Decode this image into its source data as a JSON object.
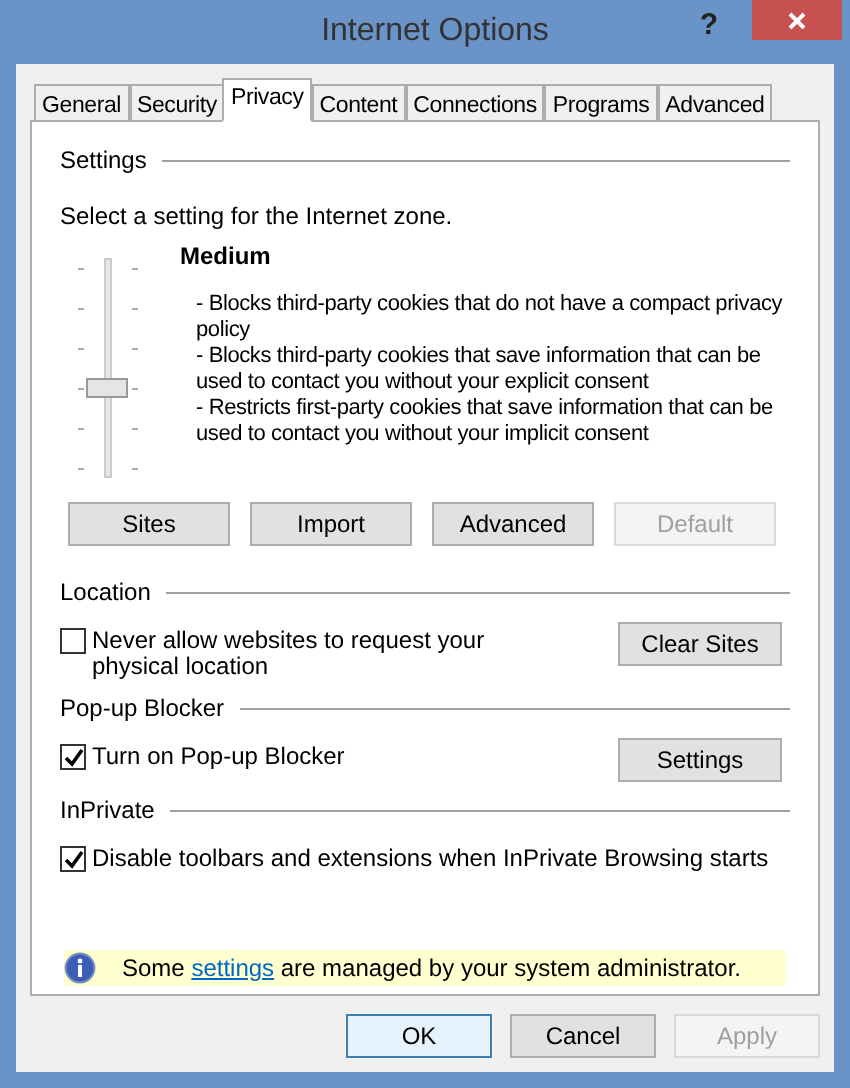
{
  "window": {
    "title": "Internet Options",
    "help": "?"
  },
  "tabs": [
    {
      "label": "General",
      "selected": false
    },
    {
      "label": "Security",
      "selected": false
    },
    {
      "label": "Privacy",
      "selected": true
    },
    {
      "label": "Content",
      "selected": false
    },
    {
      "label": "Connections",
      "selected": false
    },
    {
      "label": "Programs",
      "selected": false
    },
    {
      "label": "Advanced",
      "selected": false
    }
  ],
  "settings": {
    "heading": "Settings",
    "prompt": "Select a setting for the Internet zone.",
    "slider": {
      "level": 0.4
    },
    "level_name": "Medium",
    "description": [
      "- Blocks third-party cookies that do not have a compact privacy policy",
      "- Blocks third-party cookies that save information that can be used to contact you without your explicit consent",
      "- Restricts first-party cookies that save information that can be used to contact you without your implicit consent"
    ],
    "buttons": [
      {
        "label": "Sites",
        "disabled": false
      },
      {
        "label": "Import",
        "disabled": false
      },
      {
        "label": "Advanced",
        "disabled": false
      },
      {
        "label": "Default",
        "disabled": true
      }
    ]
  },
  "sections": [
    {
      "heading": "Location",
      "checkbox": {
        "label": "Never allow websites to request your physical location",
        "checked": false
      },
      "button": "Clear Sites"
    },
    {
      "heading": "Pop-up Blocker",
      "checkbox": {
        "label": "Turn on Pop-up Blocker",
        "checked": true
      },
      "button": "Settings"
    },
    {
      "heading": "InPrivate",
      "checkbox": {
        "label": "Disable toolbars and extensions when InPrivate Browsing starts",
        "checked": true
      }
    }
  ],
  "info": {
    "before": "Some ",
    "link": "settings",
    "after": " are managed by your system administrator."
  },
  "footer_buttons": [
    {
      "label": "OK",
      "disabled": false,
      "default": true
    },
    {
      "label": "Cancel",
      "disabled": false,
      "default": false
    },
    {
      "label": "Apply",
      "disabled": true,
      "default": false
    }
  ]
}
